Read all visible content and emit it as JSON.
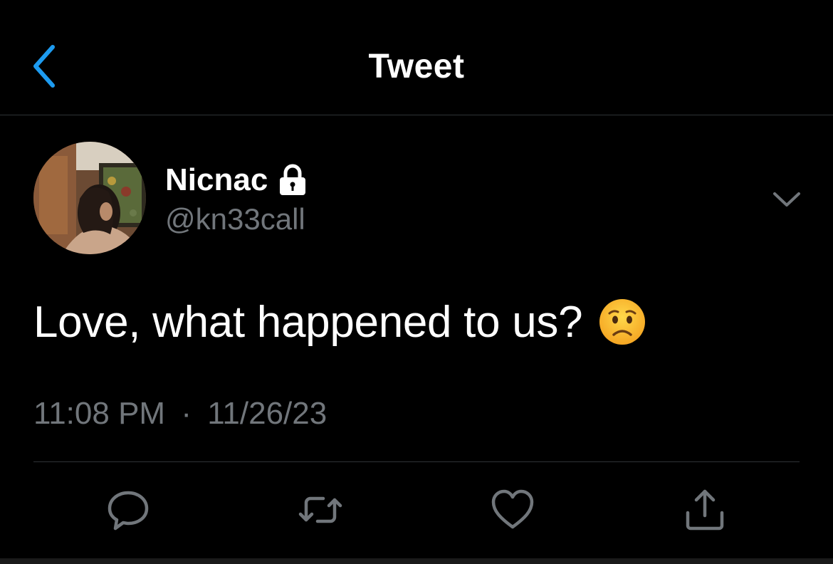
{
  "header": {
    "title": "Tweet",
    "back_icon": "chevron-left-icon"
  },
  "author": {
    "display_name": "Nicnac",
    "handle": "@kn33call",
    "protected_icon": "lock-icon",
    "avatar_icon": "avatar"
  },
  "tweet": {
    "text": "Love, what happened to us?",
    "emoji": "worried-face",
    "time": "11:08 PM",
    "separator": "·",
    "date": "11/26/23"
  },
  "actions": [
    {
      "name": "reply",
      "icon": "comment-icon"
    },
    {
      "name": "retweet",
      "icon": "retweet-icon"
    },
    {
      "name": "like",
      "icon": "heart-icon"
    },
    {
      "name": "share",
      "icon": "share-icon"
    }
  ],
  "colors": {
    "background": "#000000",
    "accent": "#1d9bf0",
    "secondary_text": "#71767b",
    "divider": "#2f3336"
  }
}
